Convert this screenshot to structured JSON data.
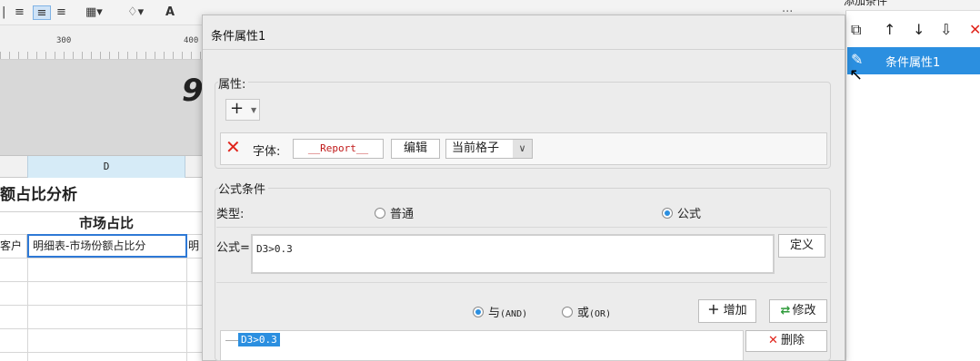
{
  "toolbar": {
    "icons": [
      "align-left-icon",
      "align-center-icon",
      "align-right-icon",
      "border-icon",
      "fill-color-icon",
      "font-color-icon"
    ]
  },
  "ruler": {
    "marks": [
      "300",
      "400"
    ]
  },
  "sheet": {
    "gray_glyph": "9",
    "column_label": "D",
    "title": "额占比分析",
    "header": "市场占比",
    "cell_customer": "客户",
    "cell_formula": "明细表-市场份额占比分",
    "cell_next": "明"
  },
  "right_panel": {
    "title": "添加条件",
    "tools": [
      "copy-icon",
      "arrow-up-icon",
      "arrow-down-icon",
      "sort-icon",
      "close-icon"
    ],
    "selected_item": "条件属性1"
  },
  "dialog": {
    "title": "条件属性1",
    "attribute": {
      "legend": "属性:",
      "add_label": "+",
      "font_label": "字体:",
      "font_preview": "Report",
      "edit_button": "编辑",
      "cell_option": "当前格子"
    },
    "formula": {
      "legend": "公式条件",
      "type_label": "类型:",
      "type_normal": "普通",
      "type_formula": "公式",
      "type_selected": "公式",
      "formula_label": "公式=",
      "formula_value": "D3>0.3",
      "define_button": "定义",
      "and_label": "与",
      "and_code": "(AND)",
      "or_label": "或",
      "or_code": "(OR)",
      "logic_selected": "AND",
      "add_button": "增加",
      "modify_button": "修改",
      "delete_button": "删除",
      "conditions": [
        "D3>0.3"
      ]
    }
  },
  "colors": {
    "accent": "#2b8fe0",
    "delete_red": "#e0241b",
    "modify_green": "#2e9a3a",
    "dialog_bg": "#ececec"
  }
}
